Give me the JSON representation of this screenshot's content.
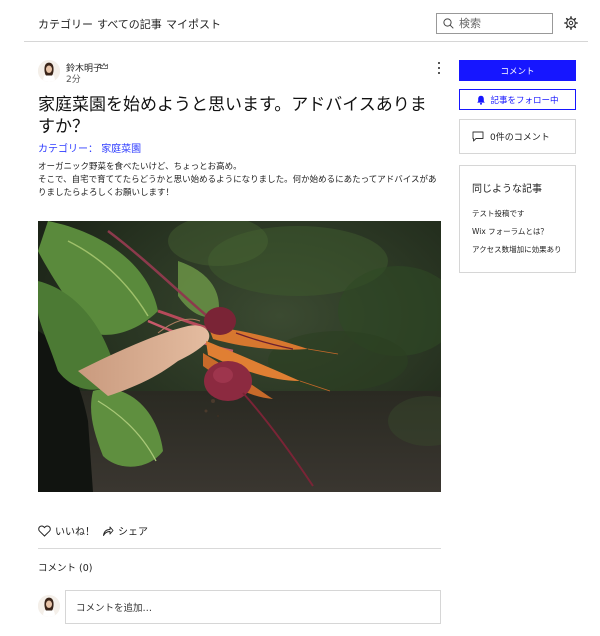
{
  "nav": {
    "items": [
      {
        "label": "カテゴリー"
      },
      {
        "label": "すべての記事"
      },
      {
        "label": "マイポスト"
      }
    ],
    "search_placeholder": "検索"
  },
  "post": {
    "author": "鈴木明子",
    "time": "2分",
    "title": "家庭菜園を始めようと思います。アドバイスありますか？",
    "category_prefix": "カテゴリー：",
    "category": "家庭菜園",
    "body": [
      "オーガニック野菜を食べたいけど、ちょっとお高め。",
      "そこで、自宅で育ててたらどうかと思い始めるようになりました。何か始めるにあたってアドバイスがありましたらよろしくお願いします！"
    ],
    "like_label": "いいね！",
    "share_label": "シェア"
  },
  "comments": {
    "heading": "コメント (0)",
    "input_placeholder": "コメントを追加…"
  },
  "sidebar": {
    "comment_button": "コメント",
    "follow_button": "記事をフォロー中",
    "comment_count": "0件のコメント",
    "related_title": "同じような記事",
    "related_items": [
      {
        "label": "テスト投稿です"
      },
      {
        "label": "Wix フォーラムとは？"
      },
      {
        "label": "アクセス数増加に効果あり"
      }
    ]
  },
  "colors": {
    "accent": "#1616ff",
    "category_link": "#2f3dff",
    "border": "#d6d6d6"
  }
}
